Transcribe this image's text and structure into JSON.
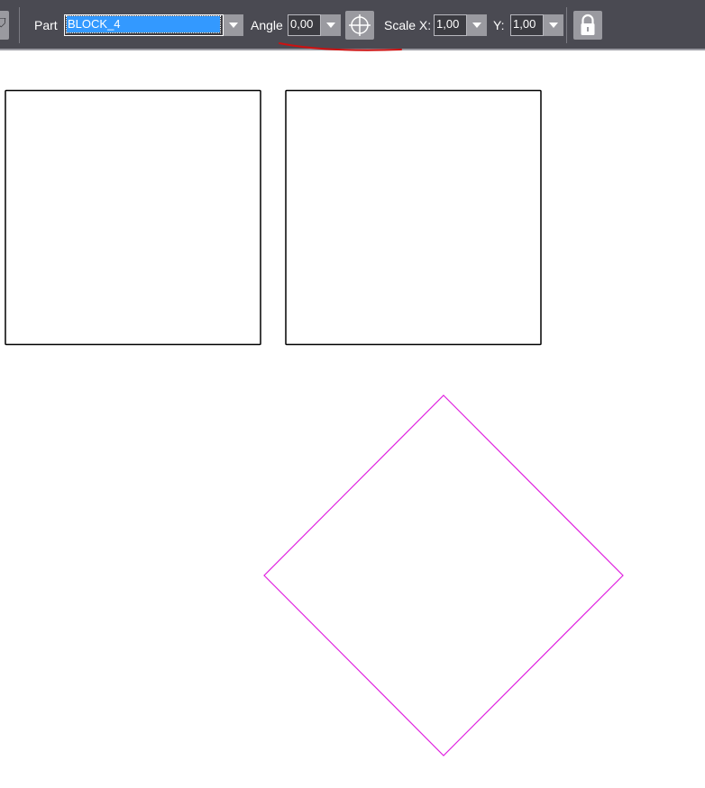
{
  "toolbar": {
    "part_label": "Part",
    "part_value": "BLOCK_4",
    "angle_label": "Angle",
    "angle_value": "0,00",
    "scale_x_label": "Scale X:",
    "scale_x_value": "1,00",
    "scale_y_label": "Y:",
    "scale_y_value": "1,00",
    "icons": {
      "left_tool": "shield-icon",
      "center_pick": "crosshair-icon",
      "lock": "lock-icon"
    }
  },
  "canvas": {
    "shapes": [
      {
        "type": "square",
        "color": "#000000"
      },
      {
        "type": "square",
        "color": "#000000"
      },
      {
        "type": "rotated-square",
        "color": "#e020e0"
      }
    ],
    "annotation_color": "#cc1111"
  }
}
